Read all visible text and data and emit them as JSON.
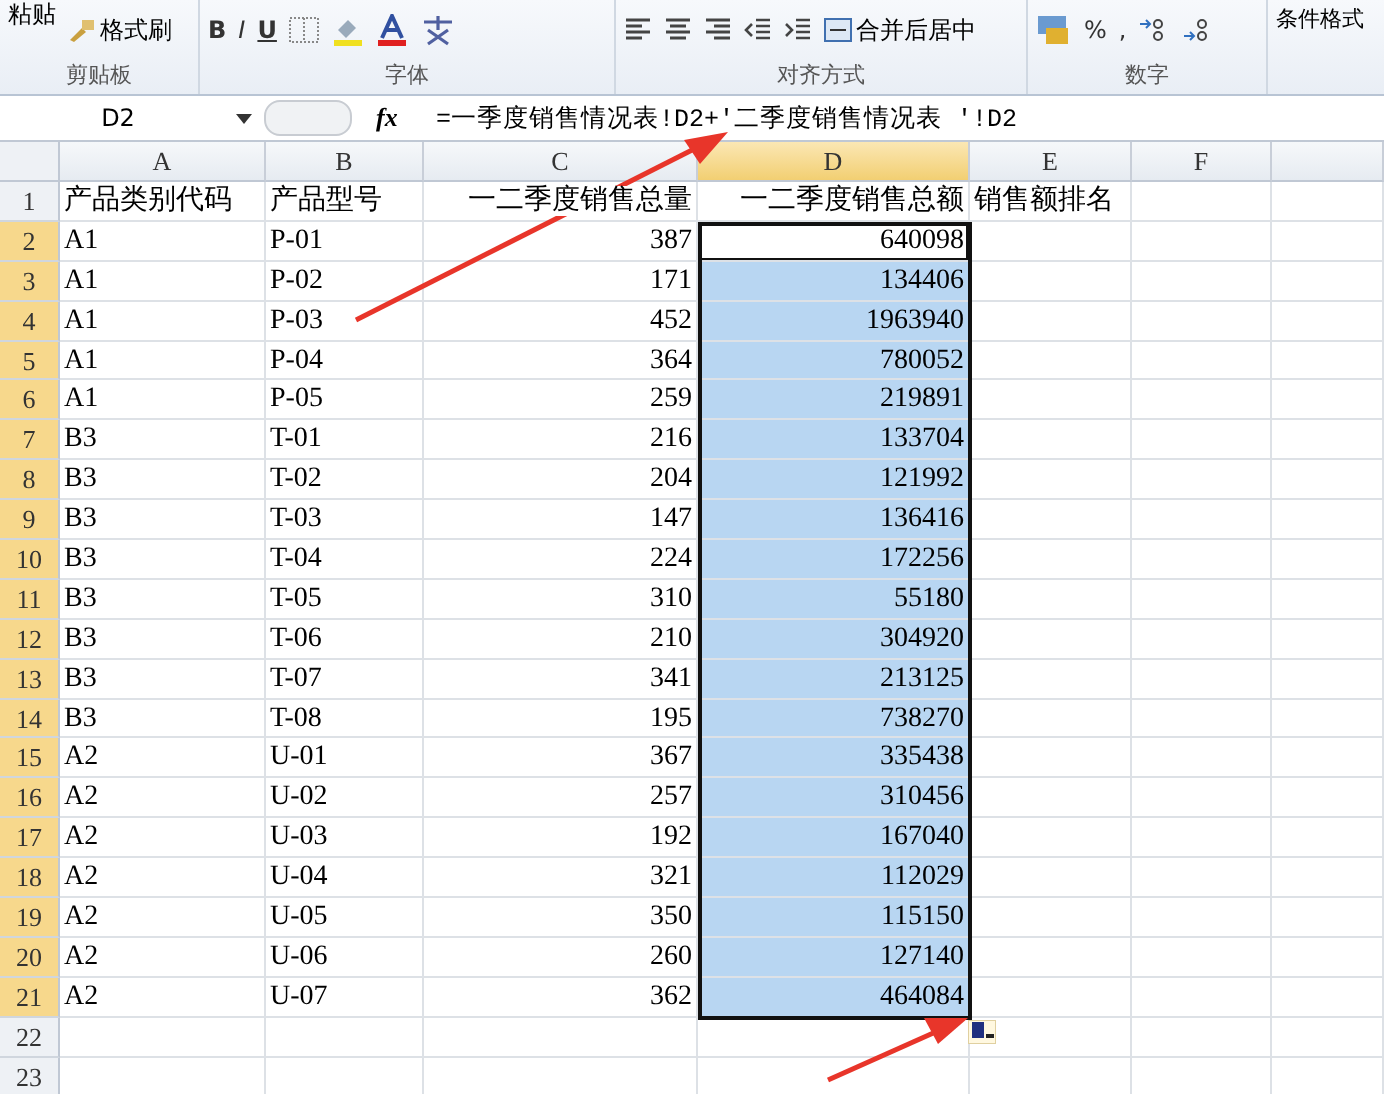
{
  "ribbon": {
    "paste": "粘贴",
    "format_painter": "格式刷",
    "bold": "B",
    "italic": "I",
    "underline": "U",
    "merge": "合并后居中",
    "percent": "%",
    "comma": ",",
    "conditional": "条件格式",
    "groups": [
      "剪贴板",
      "字体",
      "对齐方式",
      "数字"
    ]
  },
  "formula_bar": {
    "name_box": "D2",
    "fx": "fx",
    "formula": "=一季度销售情况表!D2+'二季度销售情况表 '!D2"
  },
  "sheet": {
    "columns": [
      {
        "label": "A",
        "selected": false
      },
      {
        "label": "B",
        "selected": false
      },
      {
        "label": "C",
        "selected": false
      },
      {
        "label": "D",
        "selected": true
      },
      {
        "label": "E",
        "selected": false
      },
      {
        "label": "F",
        "selected": false
      }
    ],
    "rows": [
      {
        "label": "1",
        "selected": false,
        "active": false,
        "cells": [
          "产品类别代码",
          "产品型号",
          "一二季度销售总量",
          "一二季度销售总额",
          "销售额排名"
        ]
      },
      {
        "label": "2",
        "selected": true,
        "active": true,
        "cells": [
          "A1",
          "P-01",
          "387",
          "640098",
          ""
        ]
      },
      {
        "label": "3",
        "selected": true,
        "active": false,
        "cells": [
          "A1",
          "P-02",
          "171",
          "134406",
          ""
        ]
      },
      {
        "label": "4",
        "selected": true,
        "active": false,
        "cells": [
          "A1",
          "P-03",
          "452",
          "1963940",
          ""
        ]
      },
      {
        "label": "5",
        "selected": true,
        "active": false,
        "cells": [
          "A1",
          "P-04",
          "364",
          "780052",
          ""
        ]
      },
      {
        "label": "6",
        "selected": true,
        "active": false,
        "cells": [
          "A1",
          "P-05",
          "259",
          "219891",
          ""
        ]
      },
      {
        "label": "7",
        "selected": true,
        "active": false,
        "cells": [
          "B3",
          "T-01",
          "216",
          "133704",
          ""
        ]
      },
      {
        "label": "8",
        "selected": true,
        "active": false,
        "cells": [
          "B3",
          "T-02",
          "204",
          "121992",
          ""
        ]
      },
      {
        "label": "9",
        "selected": true,
        "active": false,
        "cells": [
          "B3",
          "T-03",
          "147",
          "136416",
          ""
        ]
      },
      {
        "label": "10",
        "selected": true,
        "active": false,
        "cells": [
          "B3",
          "T-04",
          "224",
          "172256",
          ""
        ]
      },
      {
        "label": "11",
        "selected": true,
        "active": false,
        "cells": [
          "B3",
          "T-05",
          "310",
          "55180",
          ""
        ]
      },
      {
        "label": "12",
        "selected": true,
        "active": false,
        "cells": [
          "B3",
          "T-06",
          "210",
          "304920",
          ""
        ]
      },
      {
        "label": "13",
        "selected": true,
        "active": false,
        "cells": [
          "B3",
          "T-07",
          "341",
          "213125",
          ""
        ]
      },
      {
        "label": "14",
        "selected": true,
        "active": false,
        "cells": [
          "B3",
          "T-08",
          "195",
          "738270",
          ""
        ]
      },
      {
        "label": "15",
        "selected": true,
        "active": false,
        "cells": [
          "A2",
          "U-01",
          "367",
          "335438",
          ""
        ]
      },
      {
        "label": "16",
        "selected": true,
        "active": false,
        "cells": [
          "A2",
          "U-02",
          "257",
          "310456",
          ""
        ]
      },
      {
        "label": "17",
        "selected": true,
        "active": false,
        "cells": [
          "A2",
          "U-03",
          "192",
          "167040",
          ""
        ]
      },
      {
        "label": "18",
        "selected": true,
        "active": false,
        "cells": [
          "A2",
          "U-04",
          "321",
          "112029",
          ""
        ]
      },
      {
        "label": "19",
        "selected": true,
        "active": false,
        "cells": [
          "A2",
          "U-05",
          "350",
          "115150",
          ""
        ]
      },
      {
        "label": "20",
        "selected": true,
        "active": false,
        "cells": [
          "A2",
          "U-06",
          "260",
          "127140",
          ""
        ]
      },
      {
        "label": "21",
        "selected": true,
        "active": false,
        "cells": [
          "A2",
          "U-07",
          "362",
          "464084",
          ""
        ]
      },
      {
        "label": "22",
        "selected": false,
        "active": false,
        "cells": [
          "",
          "",
          "",
          "",
          ""
        ]
      },
      {
        "label": "23",
        "selected": false,
        "active": false,
        "cells": [
          "",
          "",
          "",
          "",
          ""
        ]
      }
    ]
  }
}
